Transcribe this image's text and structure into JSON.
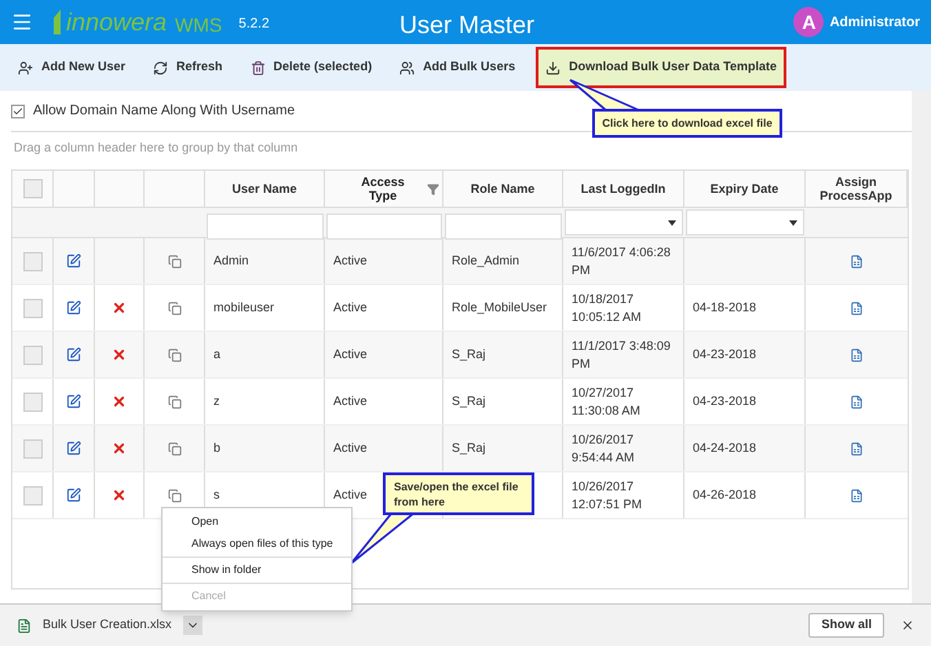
{
  "header": {
    "logo_name": "innowera",
    "logo_product": "WMS",
    "version": "5.2.2",
    "title": "User Master",
    "avatar_letter": "A",
    "user": "Administrator"
  },
  "toolbar": [
    {
      "label": "Add New User",
      "kind": "add-user",
      "highlighted": false
    },
    {
      "label": "Refresh",
      "kind": "refresh",
      "highlighted": false
    },
    {
      "label": "Delete (selected)",
      "kind": "delete",
      "highlighted": false
    },
    {
      "label": "Add Bulk Users",
      "kind": "users",
      "highlighted": false
    },
    {
      "label": "Download Bulk User Data Template",
      "kind": "download",
      "highlighted": true
    }
  ],
  "domain_option": {
    "label": "Allow Domain Name Along With Username",
    "checked": true
  },
  "group_hint": "Drag a column header here to group by that column",
  "select_all_checked": false,
  "columns": [
    {
      "label": "User Name",
      "kind": "text",
      "filter_icon": false
    },
    {
      "label": "Access Type",
      "kind": "text",
      "filter_icon": true
    },
    {
      "label": "Role Name",
      "kind": "text",
      "filter_icon": false
    },
    {
      "label": "Last LoggedIn",
      "kind": "dropdown",
      "filter_icon": false
    },
    {
      "label": "Expiry Date",
      "kind": "dropdown",
      "filter_icon": false
    },
    {
      "label": "Assign ProcessApp",
      "kind": "none",
      "filter_icon": false
    }
  ],
  "rows": [
    {
      "user": "Admin",
      "access": "Active",
      "role": "Role_Admin",
      "last_login": "11/6/2017 4:06:28 PM",
      "expiry": "",
      "deletable": false,
      "checked": false
    },
    {
      "user": "mobileuser",
      "access": "Active",
      "role": "Role_MobileUser",
      "last_login": "10/18/2017 10:05:12 AM",
      "expiry": "04-18-2018",
      "deletable": true,
      "checked": false
    },
    {
      "user": "a",
      "access": "Active",
      "role": "S_Raj",
      "last_login": "11/1/2017 3:48:09 PM",
      "expiry": "04-23-2018",
      "deletable": true,
      "checked": false
    },
    {
      "user": "z",
      "access": "Active",
      "role": "S_Raj",
      "last_login": "10/27/2017 11:30:08 AM",
      "expiry": "04-23-2018",
      "deletable": true,
      "checked": false
    },
    {
      "user": "b",
      "access": "Active",
      "role": "S_Raj",
      "last_login": "10/26/2017 9:54:44 AM",
      "expiry": "04-24-2018",
      "deletable": true,
      "checked": false
    },
    {
      "user": "s",
      "access": "Active",
      "role": "",
      "last_login": "10/26/2017 12:07:51 PM",
      "expiry": "04-26-2018",
      "deletable": true,
      "checked": false
    }
  ],
  "callouts": [
    "Click here to download excel file",
    "Save/open the excel file from here"
  ],
  "context_menu": [
    [
      {
        "label": "Open",
        "disabled": false
      },
      {
        "label": "Always open files of this type",
        "disabled": false
      }
    ],
    [
      {
        "label": "Show in folder",
        "disabled": false
      }
    ],
    [
      {
        "label": "Cancel",
        "disabled": true
      }
    ]
  ],
  "download_bar": {
    "file": "Bulk User Creation.xlsx",
    "show_all": "Show all"
  }
}
